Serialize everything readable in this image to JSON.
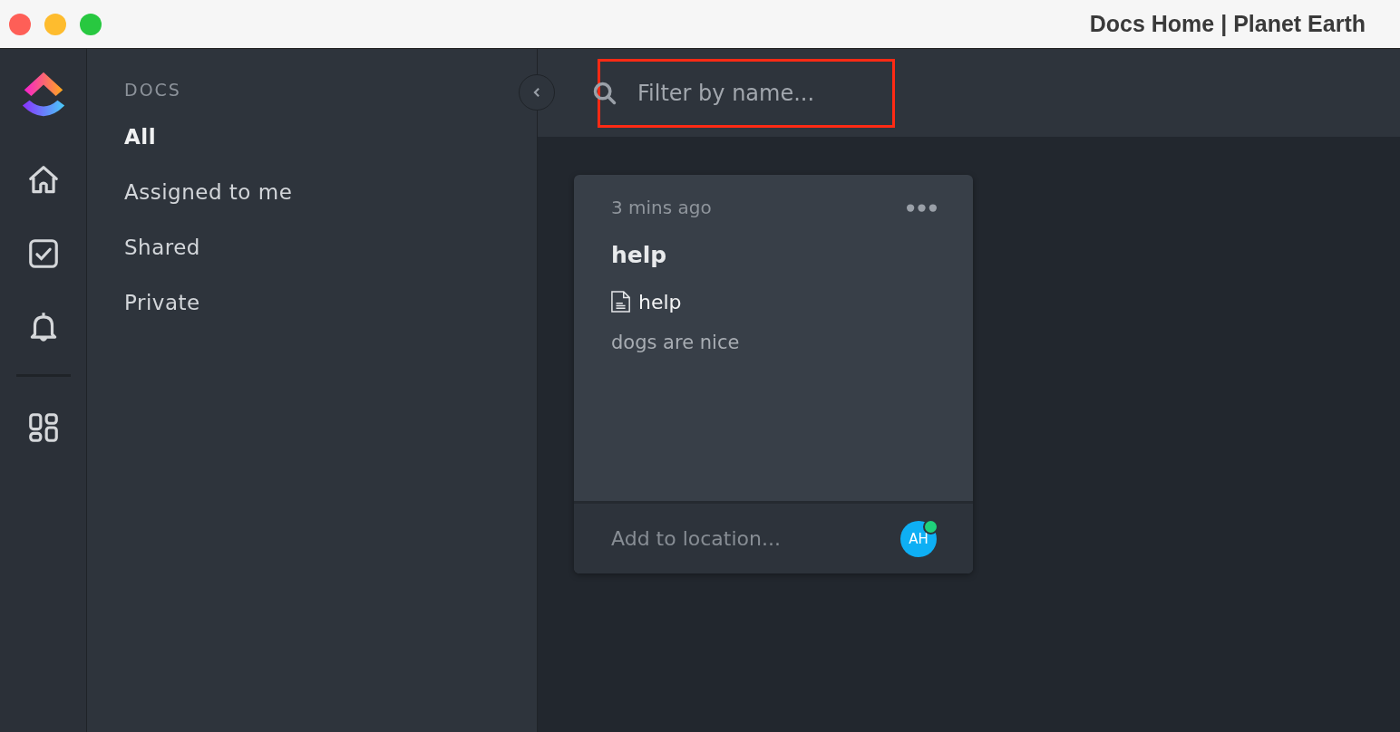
{
  "window": {
    "title": "Docs Home | Planet Earth"
  },
  "sidebar": {
    "heading": "DOCS",
    "items": [
      {
        "label": "All",
        "selected": true
      },
      {
        "label": "Assigned to me",
        "selected": false
      },
      {
        "label": "Shared",
        "selected": false
      },
      {
        "label": "Private",
        "selected": false
      }
    ]
  },
  "search": {
    "placeholder": "Filter by name...",
    "highlighted": true
  },
  "docs": [
    {
      "time": "3 mins ago",
      "title": "help",
      "page": "help",
      "preview": "dogs are nice",
      "location_placeholder": "Add to location...",
      "avatar": {
        "initials": "AH",
        "online": true
      }
    }
  ]
}
